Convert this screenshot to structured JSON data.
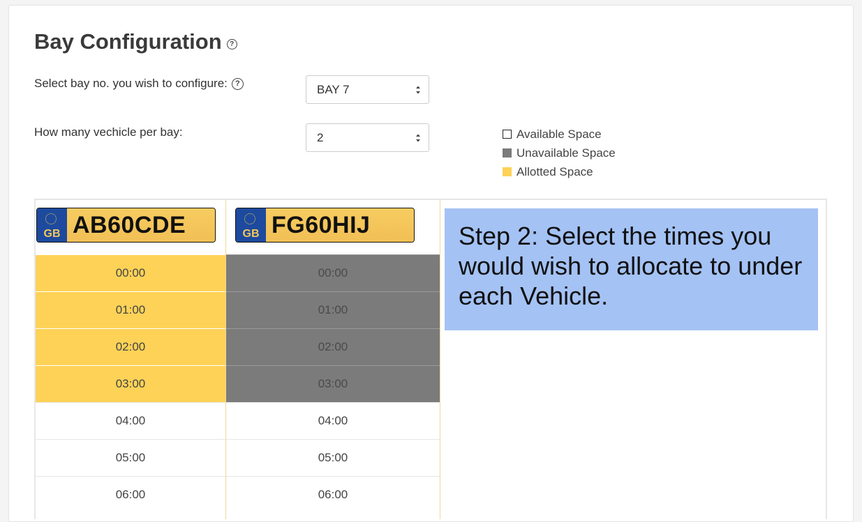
{
  "page": {
    "title": "Bay Configuration",
    "help_glyph": "?"
  },
  "form": {
    "bay_label": "Select bay no. you wish to configure:",
    "bay_value": "BAY 7",
    "vehicles_label": "How many vechicle per bay:",
    "vehicles_value": "2"
  },
  "legend": [
    {
      "label": "Available Space",
      "color": "#ffffff"
    },
    {
      "label": "Unavailable Space",
      "color": "#7b7b7b"
    },
    {
      "label": "Allotted Space",
      "color": "#fdd257"
    }
  ],
  "vehicles": [
    {
      "plate": "AB60CDE",
      "country": "GB",
      "slots": [
        {
          "time": "00:00",
          "status": "allotted"
        },
        {
          "time": "01:00",
          "status": "allotted"
        },
        {
          "time": "02:00",
          "status": "allotted"
        },
        {
          "time": "03:00",
          "status": "allotted"
        },
        {
          "time": "04:00",
          "status": "available"
        },
        {
          "time": "05:00",
          "status": "available"
        },
        {
          "time": "06:00",
          "status": "available"
        }
      ]
    },
    {
      "plate": "FG60HIJ",
      "country": "GB",
      "slots": [
        {
          "time": "00:00",
          "status": "unavailable"
        },
        {
          "time": "01:00",
          "status": "unavailable"
        },
        {
          "time": "02:00",
          "status": "unavailable"
        },
        {
          "time": "03:00",
          "status": "unavailable"
        },
        {
          "time": "04:00",
          "status": "available"
        },
        {
          "time": "05:00",
          "status": "available"
        },
        {
          "time": "06:00",
          "status": "available"
        }
      ]
    }
  ],
  "callout": {
    "text": "Step 2: Select the times you would wish to allocate to under each Vehicle."
  }
}
